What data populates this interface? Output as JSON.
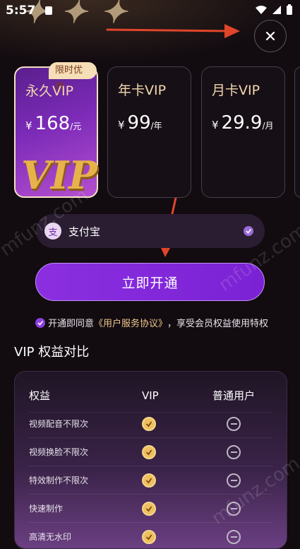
{
  "status": {
    "time": "5:57"
  },
  "plans": [
    {
      "name": "永久VIP",
      "currency": "¥",
      "amount": "168",
      "unit": "/元",
      "badge": "限时优惠",
      "selected": true
    },
    {
      "name": "年卡VIP",
      "currency": "¥",
      "amount": "99",
      "unit": "/年",
      "selected": false
    },
    {
      "name": "月卡VIP",
      "currency": "¥",
      "amount": "29.9",
      "unit": "/月",
      "selected": false
    }
  ],
  "payment": {
    "icon_char": "支",
    "label": "支付宝"
  },
  "cta_label": "立即开通",
  "agreement": {
    "prefix": "开通即同意",
    "link": "《用户服务协议》",
    "suffix": "，享受会员权益使用特权"
  },
  "comparison": {
    "title": "VIP 权益对比",
    "headers": [
      "权益",
      "VIP",
      "普通用户"
    ],
    "rows": [
      {
        "label": "视频配音不限次"
      },
      {
        "label": "视频换脸不限次"
      },
      {
        "label": "特效制作不限次"
      },
      {
        "label": "快速制作"
      },
      {
        "label": "高清无水印"
      }
    ]
  },
  "icons": {
    "close": "close-icon",
    "check": "check-icon",
    "minus": "minus-icon"
  },
  "colors": {
    "accent": "#8b2fe0",
    "gold": "#f0c060",
    "badge_bg": "#f6dfb6"
  }
}
